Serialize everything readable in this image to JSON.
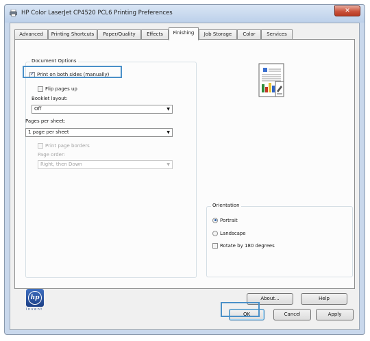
{
  "window": {
    "title": "HP Color LaserJet CP4520 PCL6 Printing Preferences",
    "close_label": "✕"
  },
  "tabs": [
    {
      "label": "Advanced",
      "active": false
    },
    {
      "label": "Printing Shortcuts",
      "active": false
    },
    {
      "label": "Paper/Quality",
      "active": false
    },
    {
      "label": "Effects",
      "active": false
    },
    {
      "label": "Finishing",
      "active": true
    },
    {
      "label": "Job Storage",
      "active": false
    },
    {
      "label": "Color",
      "active": false
    },
    {
      "label": "Services",
      "active": false
    }
  ],
  "document_options": {
    "title": "Document Options",
    "print_both_sides": {
      "label": "Print on both sides (manually)",
      "checked": true
    },
    "flip_pages_up": {
      "label": "Flip pages up",
      "checked": false
    },
    "booklet_layout": {
      "label": "Booklet layout:",
      "value": "Off"
    },
    "pages_per_sheet": {
      "label": "Pages per sheet:",
      "value": "1 page per sheet"
    },
    "print_page_borders": {
      "label": "Print page borders",
      "checked": false,
      "disabled": true
    },
    "page_order": {
      "label": "Page order:",
      "value": "Right, then Down",
      "disabled": true
    }
  },
  "orientation": {
    "title": "Orientation",
    "options": [
      {
        "label": "Portrait",
        "selected": true
      },
      {
        "label": "Landscape",
        "selected": false
      }
    ],
    "rotate": {
      "label": "Rotate by 180 degrees",
      "checked": false
    }
  },
  "buttons": {
    "about": "About...",
    "help": "Help",
    "ok": "OK",
    "cancel": "Cancel",
    "apply": "Apply"
  },
  "logo": {
    "text": "hp",
    "tagline": "invent"
  },
  "colors": {
    "highlight": "#4a90c8",
    "title_bar": "#c9d8ec",
    "close_button": "#c9523b"
  }
}
